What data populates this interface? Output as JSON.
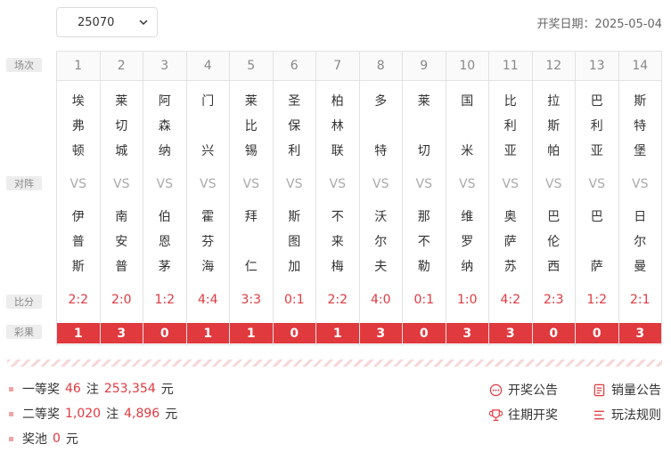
{
  "issue": {
    "selected": "25070"
  },
  "draw_date_label": "开奖日期：2025-05-04",
  "labels": {
    "match_no": "场次",
    "matchup": "对阵",
    "score": "比分",
    "result": "彩果"
  },
  "vs_text": "VS",
  "matches": [
    {
      "no": "1",
      "home": [
        "埃",
        "弗",
        "顿"
      ],
      "away": [
        "伊",
        "普",
        "斯"
      ],
      "score": "2:2",
      "result": "1"
    },
    {
      "no": "2",
      "home": [
        "莱",
        "切",
        "城"
      ],
      "away": [
        "南",
        "安",
        "普"
      ],
      "score": "2:0",
      "result": "3"
    },
    {
      "no": "3",
      "home": [
        "阿",
        "森",
        "纳"
      ],
      "away": [
        "伯",
        "恩",
        "茅"
      ],
      "score": "1:2",
      "result": "0"
    },
    {
      "no": "4",
      "home": [
        "门",
        "",
        "兴"
      ],
      "away": [
        "霍",
        "芬",
        "海"
      ],
      "score": "4:4",
      "result": "1"
    },
    {
      "no": "5",
      "home": [
        "莱",
        "比",
        "锡"
      ],
      "away": [
        "拜",
        "",
        "仁"
      ],
      "score": "3:3",
      "result": "1"
    },
    {
      "no": "6",
      "home": [
        "圣",
        "保",
        "利"
      ],
      "away": [
        "斯",
        "图",
        "加"
      ],
      "score": "0:1",
      "result": "0"
    },
    {
      "no": "7",
      "home": [
        "柏",
        "林",
        "联"
      ],
      "away": [
        "不",
        "来",
        "梅"
      ],
      "score": "2:2",
      "result": "1"
    },
    {
      "no": "8",
      "home": [
        "多",
        "",
        "特"
      ],
      "away": [
        "沃",
        "尔",
        "夫"
      ],
      "score": "4:0",
      "result": "3"
    },
    {
      "no": "9",
      "home": [
        "莱",
        "",
        "切"
      ],
      "away": [
        "那",
        "不",
        "勒"
      ],
      "score": "0:1",
      "result": "0"
    },
    {
      "no": "10",
      "home": [
        "国",
        "",
        "米"
      ],
      "away": [
        "维",
        "罗",
        "纳"
      ],
      "score": "1:0",
      "result": "3"
    },
    {
      "no": "11",
      "home": [
        "比",
        "利",
        "亚"
      ],
      "away": [
        "奥",
        "萨",
        "苏"
      ],
      "score": "4:2",
      "result": "3"
    },
    {
      "no": "12",
      "home": [
        "拉",
        "斯",
        "帕"
      ],
      "away": [
        "巴",
        "伦",
        "西"
      ],
      "score": "2:3",
      "result": "0"
    },
    {
      "no": "13",
      "home": [
        "巴",
        "利",
        "亚"
      ],
      "away": [
        "巴",
        "",
        "萨"
      ],
      "score": "1:2",
      "result": "0"
    },
    {
      "no": "14",
      "home": [
        "斯",
        "特",
        "堡"
      ],
      "away": [
        "日",
        "尔",
        "曼"
      ],
      "score": "2:1",
      "result": "3"
    }
  ],
  "prizes": {
    "first": {
      "label": "一等奖",
      "count": "46",
      "unit_count": "注",
      "amount": "253,354",
      "unit_amount": "元"
    },
    "second": {
      "label": "二等奖",
      "count": "1,020",
      "unit_count": "注",
      "amount": "4,896",
      "unit_amount": "元"
    },
    "pool": {
      "label": "奖池",
      "amount": "0",
      "unit_amount": "元"
    }
  },
  "actions": {
    "announcement": "开奖公告",
    "sales": "销量公告",
    "history": "往期开奖",
    "rules": "玩法规则"
  },
  "colors": {
    "accent": "#e0393e"
  }
}
